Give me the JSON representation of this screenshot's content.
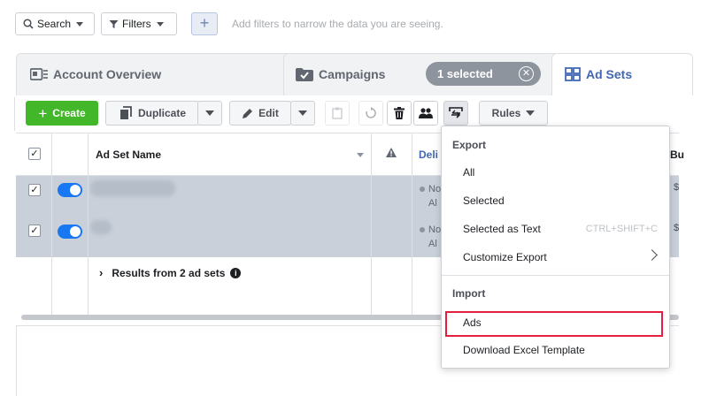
{
  "filter_bar": {
    "search_label": "Search",
    "filters_label": "Filters",
    "add_symbol": "+",
    "hint": "Add filters to narrow the data you are seeing."
  },
  "tabs": {
    "account": "Account Overview",
    "campaigns": "Campaigns",
    "selected_pill": "1 selected",
    "adsets": "Ad Sets"
  },
  "toolbar": {
    "create_label": "Create",
    "duplicate_label": "Duplicate",
    "edit_label": "Edit",
    "rules_label": "Rules"
  },
  "table": {
    "col_name": "Ad Set Name",
    "col_delivery": "Deli",
    "col_budget": "Bu",
    "rows": [
      {
        "delivery_line1": "No",
        "delivery_line2": "Al",
        "budget": "$"
      },
      {
        "delivery_line1": "No",
        "delivery_line2": "Al",
        "budget": "$"
      }
    ],
    "results": "Results from 2 ad sets"
  },
  "dropdown": {
    "export_header": "Export",
    "items": {
      "all": "All",
      "selected": "Selected",
      "selected_text": "Selected as Text",
      "selected_text_shortcut": "CTRL+SHIFT+C",
      "customize": "Customize Export"
    },
    "import_header": "Import",
    "ads": "Ads",
    "template": "Download Excel Template"
  },
  "colors": {
    "accent_blue": "#4267b2",
    "create_green": "#42b72a",
    "toggle_blue": "#1877f2",
    "highlight_red": "#e41e3f",
    "row_selected": "#c9d0da"
  }
}
